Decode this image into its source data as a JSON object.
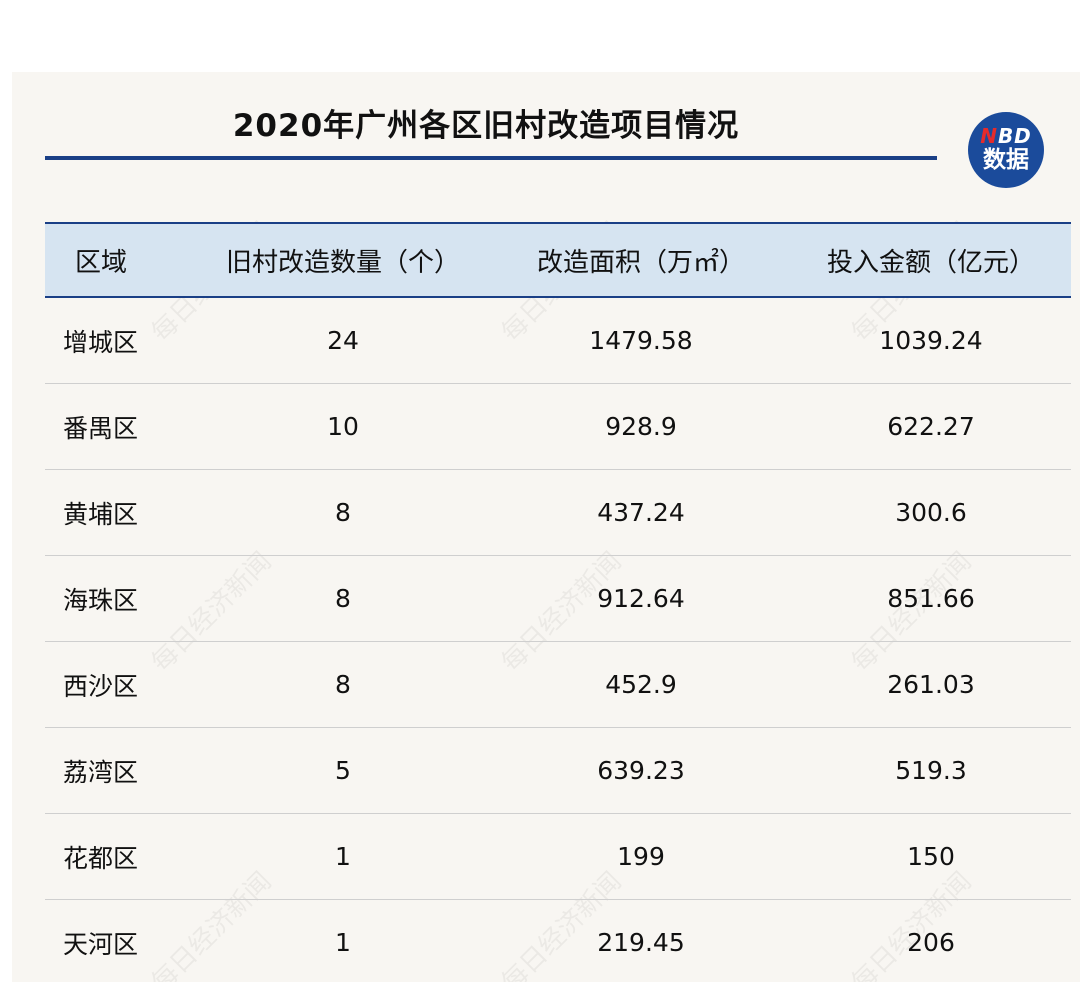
{
  "chart_data": {
    "type": "table",
    "title": "2020年广州各区旧村改造项目情况",
    "columns": [
      "区域",
      "旧村改造数量（个）",
      "改造面积（万㎡）",
      "投入金额（亿元）"
    ],
    "rows": [
      [
        "增城区",
        "24",
        "1479.58",
        "1039.24"
      ],
      [
        "番禺区",
        "10",
        "928.9",
        "622.27"
      ],
      [
        "黄埔区",
        "8",
        "437.24",
        "300.6"
      ],
      [
        "海珠区",
        "8",
        "912.64",
        "851.66"
      ],
      [
        "西沙区",
        "8",
        "452.9",
        "261.03"
      ],
      [
        "荔湾区",
        "5",
        "639.23",
        "519.3"
      ],
      [
        "花都区",
        "1",
        "199",
        "150"
      ],
      [
        "天河区",
        "1",
        "219.45",
        "206"
      ]
    ]
  },
  "logo": {
    "line1_n": "N",
    "line1_rest": "BD",
    "line2": "数据"
  },
  "watermark": "每日经济新闻",
  "colors": {
    "accent": "#1a3f86",
    "header_bg": "#d6e4f1",
    "logo_bg": "#1b4b9b",
    "logo_n": "#e52b2b",
    "background": "#f8f6f2"
  }
}
